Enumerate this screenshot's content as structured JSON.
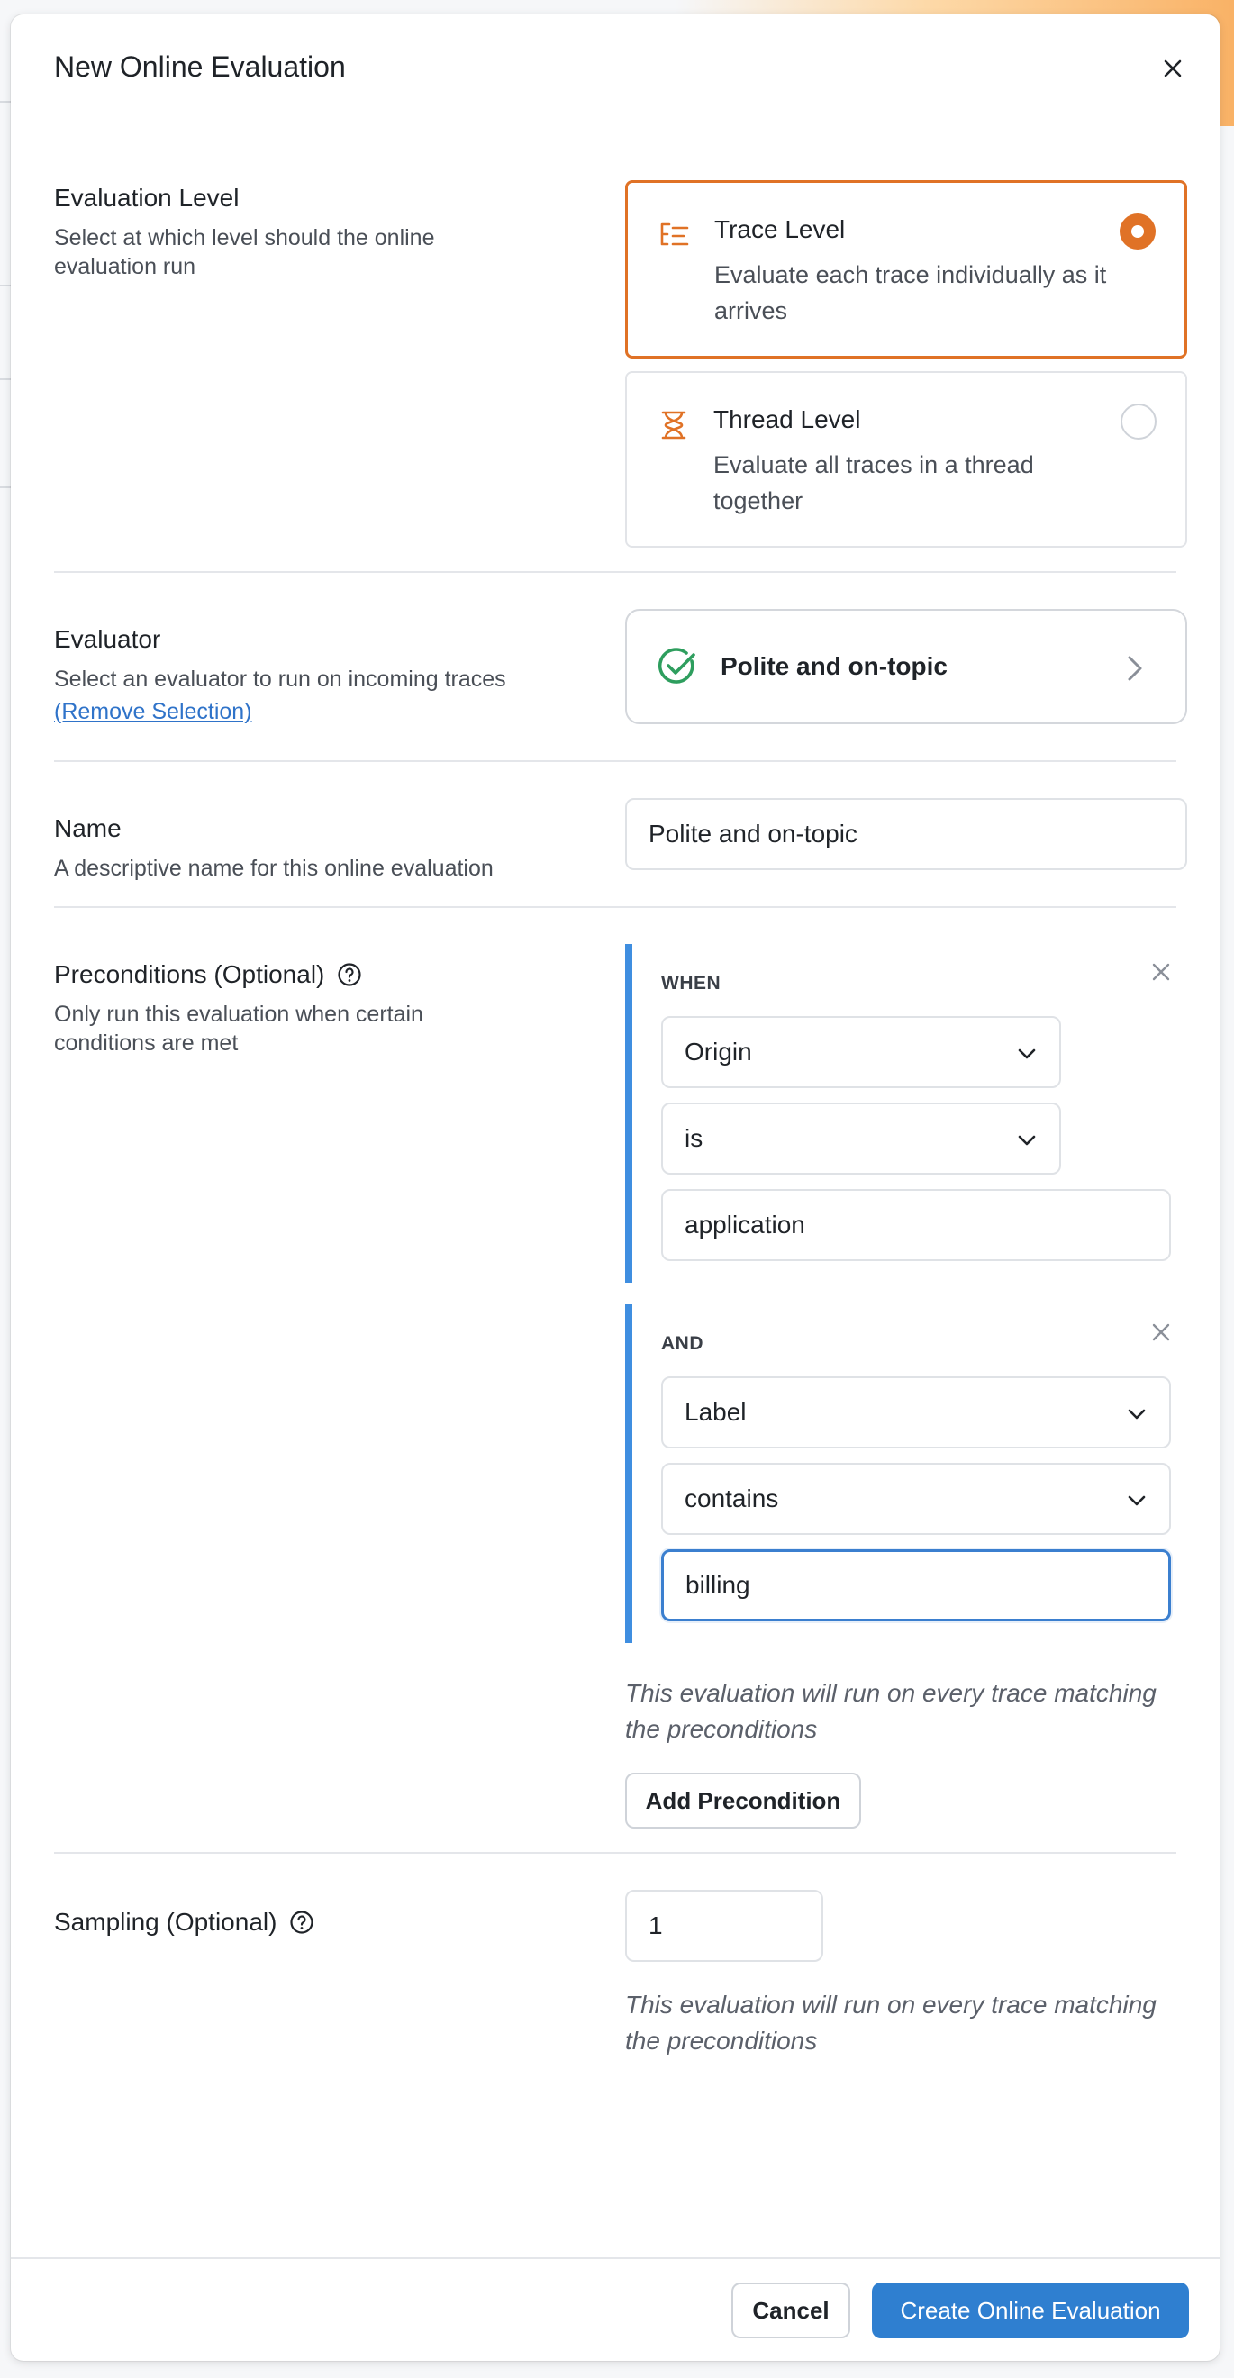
{
  "modal": {
    "title": "New Online Evaluation"
  },
  "evaluation_level": {
    "title": "Evaluation Level",
    "description": "Select at which level should the online evaluation run",
    "options": [
      {
        "title": "Trace Level",
        "description": "Evaluate each trace individually as it arrives",
        "icon": "list-tree-icon",
        "selected": true
      },
      {
        "title": "Thread Level",
        "description": "Evaluate all traces in a thread together",
        "icon": "hourglass-thread-icon",
        "selected": false
      }
    ]
  },
  "evaluator": {
    "title": "Evaluator",
    "description": "Select an evaluator to run on incoming traces",
    "remove_link": "(Remove Selection)",
    "selected_name": "Polite and on-topic"
  },
  "name": {
    "title": "Name",
    "description": "A descriptive name for this online evaluation",
    "value": "Polite and on-topic"
  },
  "preconditions": {
    "title": "Preconditions (Optional)",
    "description": "Only run this evaluation when certain conditions are met",
    "conditions": [
      {
        "connector": "WHEN",
        "field": "Origin",
        "operator": "is",
        "value": "application"
      },
      {
        "connector": "AND",
        "field": "Label",
        "operator": "contains",
        "value": "billing"
      }
    ],
    "note": "This evaluation will run on every trace matching the preconditions",
    "add_button": "Add Precondition"
  },
  "sampling": {
    "title": "Sampling (Optional)",
    "value": "1",
    "note": "This evaluation will run on every trace matching the preconditions"
  },
  "footer": {
    "cancel": "Cancel",
    "create": "Create Online Evaluation"
  },
  "colors": {
    "accent_orange": "#e07226",
    "primary_blue": "#2f7fd0",
    "condition_bar": "#3f8ee0",
    "check_green": "#2e9e5e"
  }
}
